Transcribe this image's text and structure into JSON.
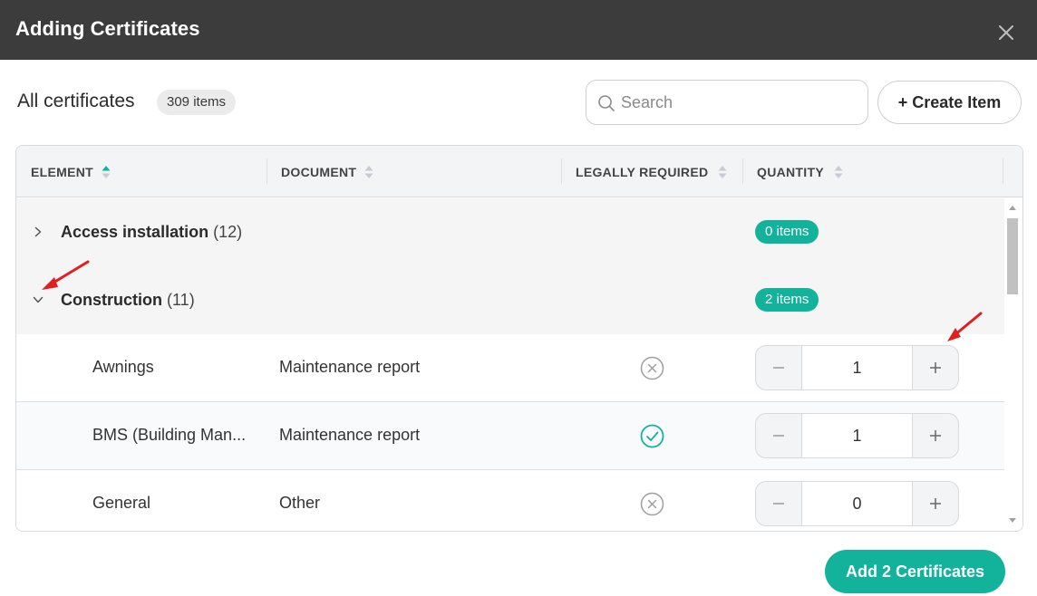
{
  "dialog": {
    "title": "Adding Certificates"
  },
  "header": {
    "heading": "All certificates",
    "count_badge": "309 items",
    "search_placeholder": "Search",
    "create_label": "+ Create Item"
  },
  "table": {
    "columns": [
      "ELEMENT",
      "DOCUMENT",
      "LEGALLY REQUIRED",
      "QUANTITY"
    ],
    "sorted_column": "ELEMENT",
    "sort_direction": "ascending",
    "groups": [
      {
        "name": "Access installation",
        "count": "(12)",
        "badge": "0 items",
        "expanded": false
      },
      {
        "name": "Construction",
        "count": "(11)",
        "badge": "2 items",
        "expanded": true
      }
    ],
    "rows": [
      {
        "element": "Awnings",
        "document": "Maintenance report",
        "legally_required": false,
        "quantity": "1"
      },
      {
        "element": "BMS (Building Man...",
        "document": "Maintenance report",
        "legally_required": true,
        "quantity": "1"
      },
      {
        "element": "General",
        "document": "Other",
        "legally_required": false,
        "quantity": "0"
      }
    ]
  },
  "footer": {
    "add_label": "Add 2 Certificates"
  },
  "colors": {
    "accent": "#12b39a",
    "titlebar": "#3c3c3c",
    "annotation_arrow": "#e02020"
  },
  "icons": {
    "close": "close-icon",
    "search": "search-icon",
    "collapsed": "chevron-right-icon",
    "expanded": "chevron-down-icon",
    "not_required": "x-circle-icon",
    "required": "check-circle-icon",
    "decrement": "minus-icon",
    "increment": "plus-icon"
  }
}
